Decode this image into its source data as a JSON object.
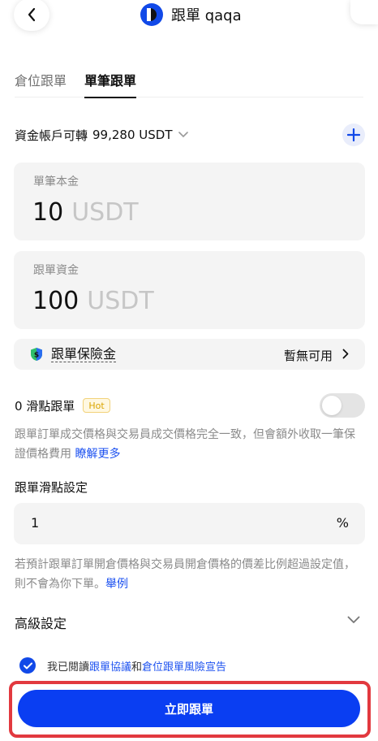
{
  "header": {
    "title": "跟單 qaqa"
  },
  "tabs": [
    {
      "label": "倉位跟單",
      "active": false
    },
    {
      "label": "單筆跟單",
      "active": true
    }
  ],
  "available": {
    "label": "資金帳戶可轉",
    "value": "99,280 USDT"
  },
  "principal": {
    "label": "單筆本金",
    "value": "10",
    "unit": "USDT"
  },
  "funds": {
    "label": "跟單資金",
    "value": "100",
    "unit": "USDT"
  },
  "insurance": {
    "label": "跟單保險金",
    "status": "暫無可用"
  },
  "slippage": {
    "label": "0 滑點跟單",
    "badge": "Hot",
    "enabled": false,
    "note": "跟單訂單成交價格與交易員成交價格完全一致，但會額外收取一筆保證價格費用",
    "note_link": "瞭解更多"
  },
  "slip_setting": {
    "label": "跟單滑點設定",
    "value": "1",
    "unit": "%",
    "note": "若預計跟單訂單開倉價格與交易員開倉價格的價差比例超過設定值，則不會為你下單。",
    "note_link": "舉例"
  },
  "advanced": {
    "label": "高級設定"
  },
  "agreement": {
    "checked": true,
    "prefix": "我已閱讀",
    "link1": "跟單協議",
    "conj": "和",
    "link2": "倉位跟單風險宣告"
  },
  "submit": {
    "label": "立即跟單"
  },
  "colors": {
    "accent": "#1149e8",
    "button": "#0a3ef2",
    "highlight_frame": "#e2393f",
    "card_bg": "#f4f4f4"
  }
}
